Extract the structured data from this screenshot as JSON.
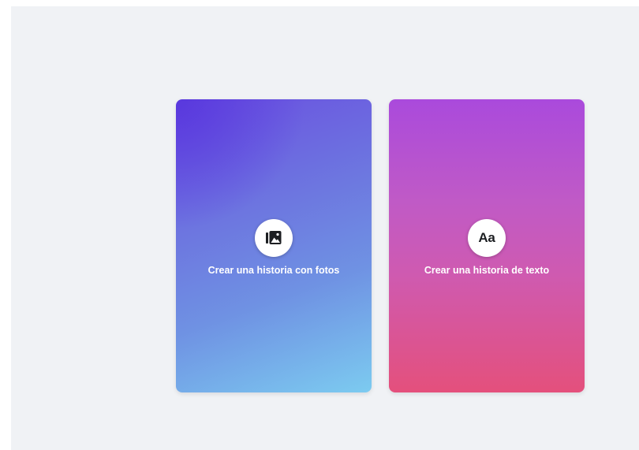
{
  "cards": {
    "photo": {
      "label": "Crear una historia con fotos",
      "icon": "photo-gallery-icon",
      "gradient_colors": [
        "#5634de",
        "#6f92e3",
        "#7ccbf0"
      ]
    },
    "text": {
      "label": "Crear una historia de texto",
      "icon_text": "Aa",
      "icon": "text-aa-icon",
      "gradient_colors": [
        "#aa4adc",
        "#cf5ab0",
        "#e4507c"
      ]
    }
  },
  "colors": {
    "page_background": "#f0f2f5",
    "label_text": "#ffffff",
    "icon_circle": "#ffffff"
  }
}
